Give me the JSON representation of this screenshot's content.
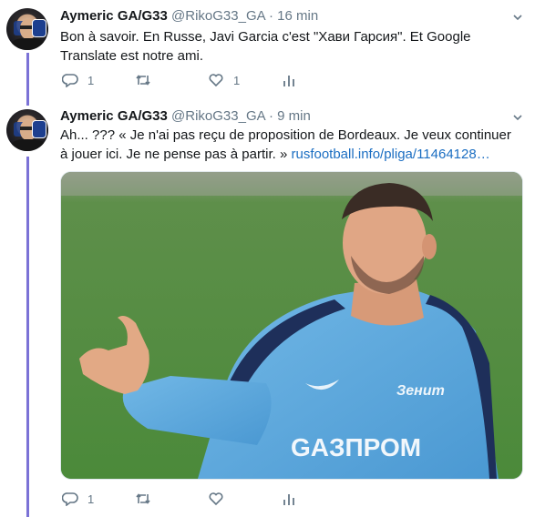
{
  "tweets": [
    {
      "author_name": "Aymeric GA/G33",
      "handle": "@RikoG33_GA",
      "separator": "·",
      "time": "16 min",
      "text": "Bon à savoir. En Russe, Javi Garcia c'est \"Хави Гарсия\". Et Google Translate est notre ami.",
      "reply_count": "1",
      "retweet_count": "",
      "like_count": "1"
    },
    {
      "author_name": "Aymeric GA/G33",
      "handle": "@RikoG33_GA",
      "separator": "·",
      "time": "9 min",
      "text": "Ah... ??? « Je n'ai pas reçu de proposition de Bordeaux. Je veux continuer à jouer ici. Je ne pense pas à partir. » ",
      "link_text": "rusfootball.info/pliga/11464128…",
      "reply_count": "1",
      "retweet_count": "",
      "like_count": ""
    }
  ],
  "media": {
    "jersey_sponsor": "GАЗПРОМ",
    "jersey_badge": "Зенит"
  },
  "colors": {
    "thread_line": "#7b72d6",
    "link": "#1b6ec2",
    "muted": "#657786",
    "pitch": "#4f8a3f",
    "jersey": "#5aa7dc"
  },
  "icons": [
    "reply-icon",
    "retweet-icon",
    "like-icon",
    "analytics-icon",
    "chevron-down-icon"
  ]
}
